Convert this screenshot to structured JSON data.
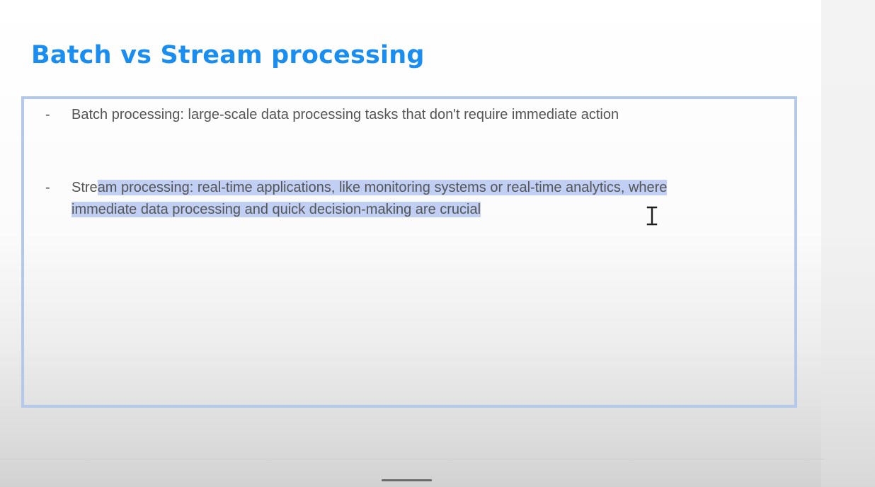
{
  "slide": {
    "title": "Batch vs Stream processing",
    "bullets": [
      {
        "dash": "-",
        "text": "Batch processing: large-scale data processing tasks that don't require immediate action"
      },
      {
        "dash": "-",
        "line1_plain": "Stre",
        "line1_selected": "am processing: real-time applications, like monitoring systems or real-time analytics, where ",
        "line2_selected": "immediate data processing and quick decision-making are crucial "
      }
    ]
  },
  "colors": {
    "title": "#1a8ef0",
    "text": "#555555",
    "box_border": "#b4c8ea",
    "selection": "#c0cff3"
  },
  "cursor": "text-cursor-icon"
}
